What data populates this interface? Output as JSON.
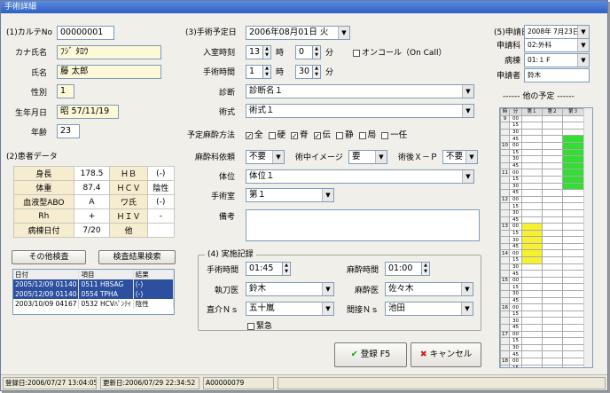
{
  "window": {
    "title": "手術詳細"
  },
  "patient": {
    "chart_label": "(1)カルテNo",
    "chart_no": "00000001",
    "kana_label": "カナ氏名",
    "kana": "ﾌｼﾞ ﾀﾛｳ",
    "name_label": "氏名",
    "name": "藤 太郎",
    "sex_label": "性別",
    "sex": "1",
    "dob_label": "生年月日",
    "dob": "昭 57/11/19",
    "age_label": "年齢",
    "age": "23"
  },
  "data_section": {
    "label": "(2)患者データ",
    "rows": [
      [
        "身長",
        "178.5",
        "ＨＢ",
        "(-)"
      ],
      [
        "体重",
        "87.4",
        "ＨＣＶ",
        "陰性"
      ],
      [
        "血液型ABO",
        "A",
        "ワ氏",
        "(-)"
      ],
      [
        "Rh",
        "+",
        "ＨＩＶ",
        "-"
      ],
      [
        "病棟日付",
        "7/20",
        "他",
        ""
      ]
    ],
    "other_tests_button": "その他検査",
    "results_button": "検査結果検索",
    "list_headers": [
      "日付",
      "項目",
      "結果"
    ],
    "list_rows": [
      {
        "date": "2005/12/09",
        "time": "01140",
        "item": "0511 HBSAG",
        "result": "(-)"
      },
      {
        "date": "2005/12/09",
        "time": "01140",
        "item": "0554 TPHA",
        "result": "(-)"
      },
      {
        "date": "2003/10/09",
        "time": "04167",
        "item": "0532 HCVﾊﾟﾝﾃｲ",
        "result": "陰性"
      }
    ]
  },
  "surgery": {
    "date_label": "(3)手術予定日",
    "date": "2006年08月01日 火",
    "entry_label": "入室時刻",
    "entry_h": "13",
    "entry_m": "0",
    "hour": "時",
    "minute": "分",
    "oncall_label": "オンコール（On Call）",
    "dur_label": "手術時間",
    "dur_h": "1",
    "dur_m": "30",
    "diag_label": "診断",
    "diag": "診断名１",
    "proc_label": "術式",
    "proc": "術式１",
    "anes_label": "予定麻酔方法",
    "anes_opts": [
      {
        "label": "全",
        "checked": true
      },
      {
        "label": "硬",
        "checked": false
      },
      {
        "label": "脊",
        "checked": true
      },
      {
        "label": "伝",
        "checked": true
      },
      {
        "label": "静",
        "checked": false
      },
      {
        "label": "局",
        "checked": false
      },
      {
        "label": "一任",
        "checked": false
      }
    ],
    "prep_label": "麻酔科依頼",
    "prep": "不要",
    "img_label": "術中イメージ",
    "img": "要",
    "xp_label": "術後Ｘ－Ｐ",
    "xp": "不要",
    "pos_label": "体位",
    "pos": "体位１",
    "room_label": "手術室",
    "room": "第１",
    "note_label": "備考"
  },
  "record": {
    "label": "(4) 実施記録",
    "optime_label": "手術時間",
    "optime": "01:45",
    "anestime_label": "麻酔時間",
    "anestime": "01:00",
    "surgeon_label": "執刀医",
    "surgeon": "鈴木",
    "anesth_label": "麻酔医",
    "anesth": "佐々木",
    "nurse1_label": "直介Ｎｓ",
    "nurse1": "五十嵐",
    "nurse2_label": "間接Ｎｓ",
    "nurse2": "池田",
    "urgent_label": "緊急"
  },
  "request": {
    "date_label": "(5)申請日",
    "date": "2008年 7月23日",
    "dept_label": "申請科",
    "dept": "02:外科",
    "ward_label": "病棟",
    "ward": "01:１Ｆ",
    "requester_label": "申請者",
    "requester": "鈴木",
    "schedule_label": "------ 他の予定 ------",
    "sched_headers": [
      "時",
      "分",
      "第１",
      "第２",
      "第３"
    ]
  },
  "buttons": {
    "register": "登録",
    "register_key": "F5",
    "cancel": "キャンセル"
  },
  "status": {
    "created": "登録日:2006/07/27 13:04:05",
    "updated": "更新日:2006/07/29 22:34:52",
    "id": "A00000079"
  },
  "colors": {
    "accent_green": "#33dd33",
    "accent_yellow": "#f5f030",
    "title": "#2f5fc4"
  }
}
